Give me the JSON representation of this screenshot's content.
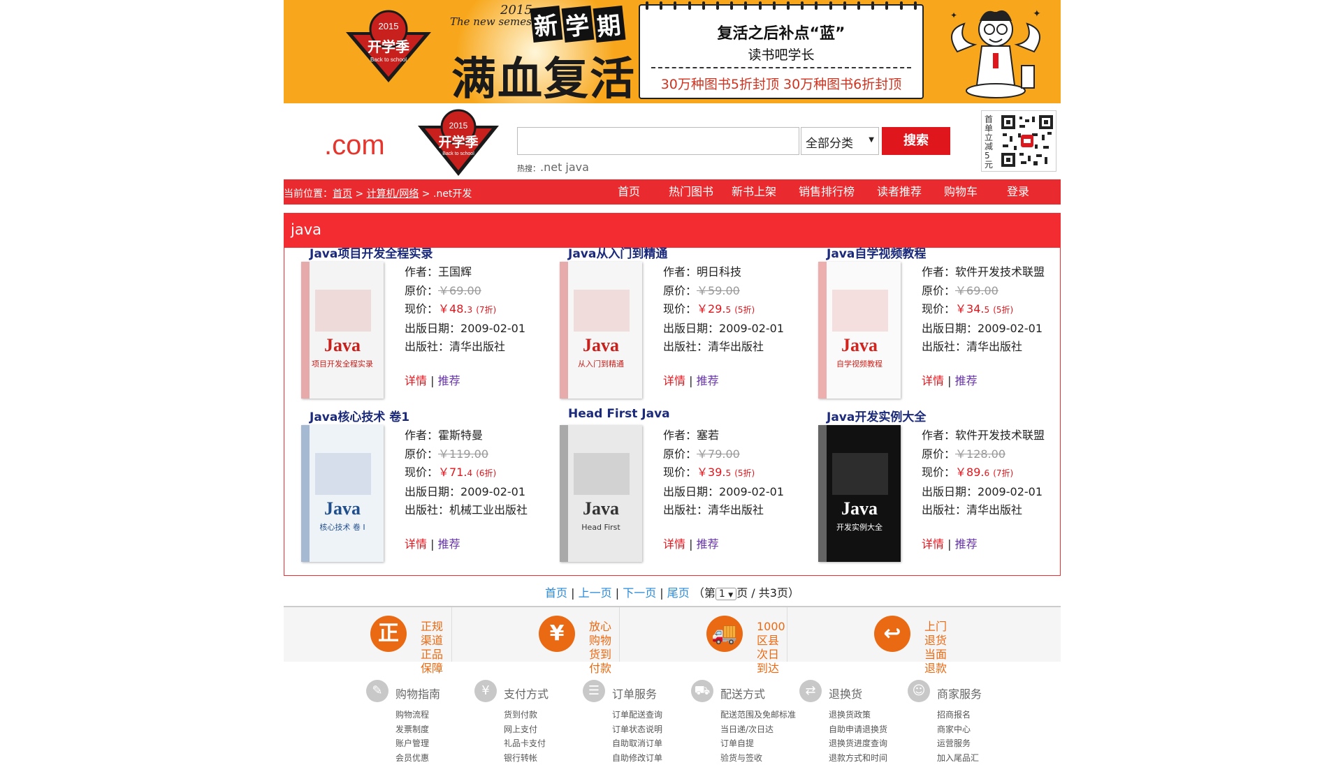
{
  "banner": {
    "badge_year": "2015",
    "badge_main": "开学季",
    "badge_sub": "Back to school",
    "year_script": "2015",
    "semester_en": "The new semester",
    "xinxueqi": [
      "新",
      "学",
      "期"
    ],
    "big_text": "满血复活",
    "paper_line1": "复活之后补点“蓝”",
    "paper_line2": "读书吧学长",
    "paper_line3": "30万种图书5折封顶   30万种图书6折封顶"
  },
  "header": {
    "dotcom": ".com",
    "badge_year": "2015",
    "badge_main": "开学季",
    "badge_sub": "Back to school",
    "search_value": "",
    "category_selected": "全部分类",
    "search_button": "搜索",
    "hot_label": "热搜：",
    "hot_keywords": ".net  java",
    "qr_text": "首单立减5元"
  },
  "breadcrumb": {
    "prefix": "当前位置：",
    "home": "首页",
    "sep1": " > ",
    "category": "计算机/网络",
    "sep2": " > ",
    "current": ".net开发"
  },
  "nav": [
    "首页",
    "热门图书",
    "新书上架",
    "销售排行榜",
    "读者推荐",
    "购物车",
    "登录"
  ],
  "results": {
    "title": "java",
    "labels": {
      "author": "作者：",
      "orig": "原价：",
      "now": "现价：",
      "date": "出版日期：",
      "publisher": "出版社：",
      "detail": "详情",
      "divider": " | ",
      "recommend": "推荐"
    },
    "books": [
      {
        "title": "Java项目开发全程实录",
        "author": "王国辉",
        "orig": "￥69.00",
        "now_main": "￥48.",
        "now_small": "3",
        "discount": "(7折)",
        "date": "2009-02-01",
        "publisher": "清华出版社",
        "cover_text": "Java",
        "cover_sub": "项目开发全程实录",
        "cover_bg": "#f4f4f4",
        "cover_fg": "#c8201c"
      },
      {
        "title": "Java从入门到精通",
        "author": "明日科技",
        "orig": "￥59.00",
        "now_main": "￥29.",
        "now_small": "5",
        "discount": "(5折)",
        "date": "2009-02-01",
        "publisher": "清华出版社",
        "cover_text": "Java",
        "cover_sub": "从入门到精通",
        "cover_bg": "#f6f6f6",
        "cover_fg": "#c8201c"
      },
      {
        "title": "Java自学视频教程",
        "author": "软件开发技术联盟",
        "orig": "￥69.00",
        "now_main": "￥34.",
        "now_small": "5",
        "discount": "(5折)",
        "date": "2009-02-01",
        "publisher": "清华出版社",
        "cover_text": "Java",
        "cover_sub": "自学视频教程",
        "cover_bg": "#fafafa",
        "cover_fg": "#d2231c"
      },
      {
        "title": "Java核心技术 卷1",
        "author": "霍斯特曼",
        "orig": "￥119.00",
        "now_main": "￥71.",
        "now_small": "4",
        "discount": "(6折)",
        "date": "2009-02-01",
        "publisher": "机械工业出版社",
        "cover_text": "Java",
        "cover_sub": "核心技术 卷 I",
        "cover_bg": "#eef3f8",
        "cover_fg": "#1f4e8c"
      },
      {
        "title": "Head First Java",
        "author": "塞若",
        "orig": "￥79.00",
        "now_main": "￥39.",
        "now_small": "5",
        "discount": "(5折)",
        "date": "2009-02-01",
        "publisher": "清华出版社",
        "cover_text": "Java",
        "cover_sub": "Head First",
        "cover_bg": "#e9e9e9",
        "cover_fg": "#333333"
      },
      {
        "title": "Java开发实例大全",
        "author": "软件开发技术联盟",
        "orig": "￥128.00",
        "now_main": "￥89.",
        "now_small": "6",
        "discount": "(7折)",
        "date": "2009-02-01",
        "publisher": "清华出版社",
        "cover_text": "Java",
        "cover_sub": "开发实例大全",
        "cover_bg": "#111111",
        "cover_fg": "#ffffff"
      }
    ]
  },
  "pager": {
    "first": "首页",
    "prev": "上一页",
    "next": "下一页",
    "last": "尾页",
    "sep": " | ",
    "before_page": "（第",
    "page": "1",
    "after_page": "页 / 共3页）"
  },
  "guarantees": [
    {
      "icon": "正",
      "line1": "正规渠道",
      "line2": "正品保障"
    },
    {
      "icon": "¥",
      "line1": "放心购物",
      "line2": "货到付款"
    },
    {
      "icon": "🚚",
      "line1": "1000区县",
      "line2": "次日到达"
    },
    {
      "icon": "↩",
      "line1": "上门退货",
      "line2": "当面退款"
    }
  ],
  "footer": [
    {
      "title": "购物指南",
      "icon": "✎",
      "items": [
        "购物流程",
        "发票制度",
        "账户管理",
        "会员优惠"
      ]
    },
    {
      "title": "支付方式",
      "icon": "¥",
      "items": [
        "货到付款",
        "网上支付",
        "礼品卡支付",
        "银行转帐"
      ]
    },
    {
      "title": "订单服务",
      "icon": "☰",
      "items": [
        "订单配送查询",
        "订单状态说明",
        "自助取消订单",
        "自助修改订单"
      ]
    },
    {
      "title": "配送方式",
      "icon": "⛟",
      "items": [
        "配送范围及免邮标准",
        "当日递/次日达",
        "订单自提",
        "验货与签收"
      ]
    },
    {
      "title": "退换货",
      "icon": "⇄",
      "items": [
        "退换货政策",
        "自助申请退换货",
        "退换货进度查询",
        "退款方式和时间"
      ]
    },
    {
      "title": "商家服务",
      "icon": "☺",
      "items": [
        "招商报名",
        "商家中心",
        "运营服务",
        "加入尾品汇"
      ]
    }
  ]
}
